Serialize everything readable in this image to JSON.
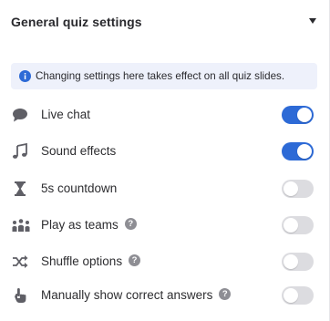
{
  "panel": {
    "title": "General quiz settings",
    "collapse_icon": "caret-down-icon"
  },
  "info": {
    "icon": "info-icon",
    "text": "Changing settings here takes effect on all quiz slides."
  },
  "settings": [
    {
      "id": "live-chat",
      "icon": "chat-bubble-icon",
      "label": "Live chat",
      "enabled": true,
      "has_help": false
    },
    {
      "id": "sound-effects",
      "icon": "music-note-icon",
      "label": "Sound effects",
      "enabled": true,
      "has_help": false
    },
    {
      "id": "countdown",
      "icon": "hourglass-icon",
      "label": "5s countdown",
      "enabled": false,
      "has_help": false
    },
    {
      "id": "play-as-teams",
      "icon": "team-icon",
      "label": "Play as teams",
      "enabled": false,
      "has_help": true
    },
    {
      "id": "shuffle-options",
      "icon": "shuffle-icon",
      "label": "Shuffle options",
      "enabled": false,
      "has_help": true
    },
    {
      "id": "manually-show-answers",
      "icon": "pointing-hand-icon",
      "label": "Manually show correct answers",
      "enabled": false,
      "has_help": true
    }
  ],
  "colors": {
    "accent": "#2d6ad6",
    "toggle_off": "#dcdce0",
    "banner_bg": "#eef1fb",
    "icon_gray": "#5f5f66",
    "help_gray": "#8e8e94"
  }
}
